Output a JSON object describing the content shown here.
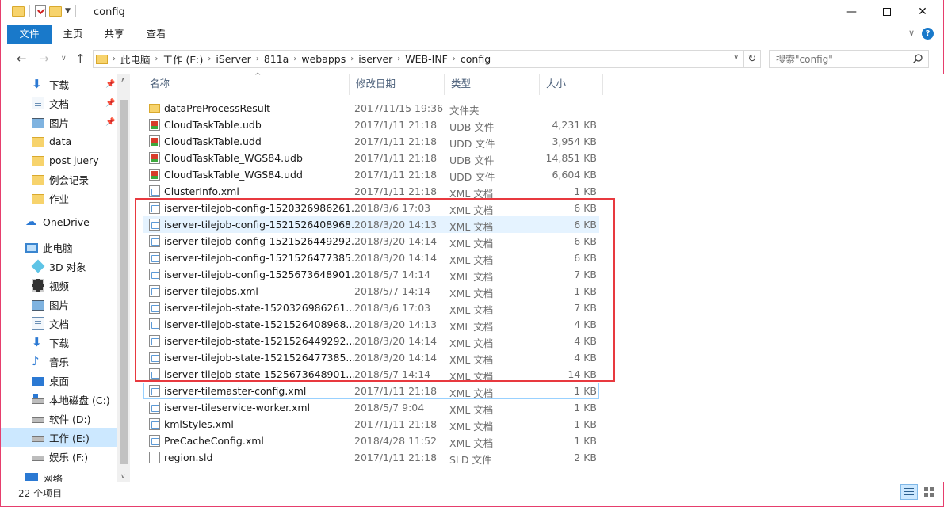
{
  "window": {
    "title": "config"
  },
  "ribbon": {
    "tabs": [
      "文件",
      "主页",
      "共享",
      "查看"
    ]
  },
  "address": {
    "crumbs": [
      "此电脑",
      "工作 (E:)",
      "iServer",
      "811a",
      "webapps",
      "iserver",
      "WEB-INF",
      "config"
    ],
    "search_placeholder": "搜索\"config\""
  },
  "nav": {
    "items": [
      {
        "label": "下载",
        "icon": "download-icon",
        "pinned": true
      },
      {
        "label": "文档",
        "icon": "document-icon",
        "pinned": true
      },
      {
        "label": "图片",
        "icon": "pictures-icon",
        "pinned": true
      },
      {
        "label": "data",
        "icon": "folder-icon",
        "pinned": false
      },
      {
        "label": "post juery",
        "icon": "folder-icon",
        "pinned": false
      },
      {
        "label": "例会记录",
        "icon": "folder-icon",
        "pinned": false
      },
      {
        "label": "作业",
        "icon": "folder-icon",
        "pinned": false
      },
      {
        "label": "OneDrive",
        "icon": "onedrive-icon",
        "pinned": false
      },
      {
        "label": "此电脑",
        "icon": "this-pc-icon",
        "pinned": false
      },
      {
        "label": "3D 对象",
        "icon": "3d-objects-icon",
        "pinned": false
      },
      {
        "label": "视频",
        "icon": "video-icon",
        "pinned": false
      },
      {
        "label": "图片",
        "icon": "pictures-icon",
        "pinned": false
      },
      {
        "label": "文档",
        "icon": "document-icon",
        "pinned": false
      },
      {
        "label": "下载",
        "icon": "download-icon",
        "pinned": false
      },
      {
        "label": "音乐",
        "icon": "music-icon",
        "pinned": false
      },
      {
        "label": "桌面",
        "icon": "desktop-icon",
        "pinned": false
      },
      {
        "label": "本地磁盘 (C:)",
        "icon": "system-drive-icon",
        "pinned": false
      },
      {
        "label": "软件 (D:)",
        "icon": "drive-icon",
        "pinned": false
      },
      {
        "label": "工作 (E:)",
        "icon": "drive-icon",
        "pinned": false,
        "selected": true
      },
      {
        "label": "娱乐 (F:)",
        "icon": "drive-icon",
        "pinned": false
      },
      {
        "label": "网络",
        "icon": "network-icon",
        "pinned": false
      }
    ]
  },
  "columns": [
    "名称",
    "修改日期",
    "类型",
    "大小"
  ],
  "files": [
    {
      "name": "dataPreProcessResult",
      "date": "2017/11/15 19:36",
      "type": "文件夹",
      "size": "",
      "icon": "folder-icon"
    },
    {
      "name": "CloudTaskTable.udb",
      "date": "2017/1/11 21:18",
      "type": "UDB 文件",
      "size": "4,231 KB",
      "icon": "udb-file-icon"
    },
    {
      "name": "CloudTaskTable.udd",
      "date": "2017/1/11 21:18",
      "type": "UDD 文件",
      "size": "3,954 KB",
      "icon": "udb-file-icon"
    },
    {
      "name": "CloudTaskTable_WGS84.udb",
      "date": "2017/1/11 21:18",
      "type": "UDB 文件",
      "size": "14,851 KB",
      "icon": "udb-file-icon"
    },
    {
      "name": "CloudTaskTable_WGS84.udd",
      "date": "2017/1/11 21:18",
      "type": "UDD 文件",
      "size": "6,604 KB",
      "icon": "udb-file-icon"
    },
    {
      "name": "ClusterInfo.xml",
      "date": "2017/1/11 21:18",
      "type": "XML 文档",
      "size": "1 KB",
      "icon": "xml-file-icon"
    },
    {
      "name": "iserver-tilejob-config-1520326986261...",
      "date": "2018/3/6 17:03",
      "type": "XML 文档",
      "size": "6 KB",
      "icon": "xml-file-icon"
    },
    {
      "name": "iserver-tilejob-config-1521526408968...",
      "date": "2018/3/20 14:13",
      "type": "XML 文档",
      "size": "6 KB",
      "icon": "xml-file-icon",
      "hover": true
    },
    {
      "name": "iserver-tilejob-config-1521526449292...",
      "date": "2018/3/20 14:14",
      "type": "XML 文档",
      "size": "6 KB",
      "icon": "xml-file-icon"
    },
    {
      "name": "iserver-tilejob-config-1521526477385...",
      "date": "2018/3/20 14:14",
      "type": "XML 文档",
      "size": "6 KB",
      "icon": "xml-file-icon"
    },
    {
      "name": "iserver-tilejob-config-1525673648901...",
      "date": "2018/5/7 14:14",
      "type": "XML 文档",
      "size": "7 KB",
      "icon": "xml-file-icon"
    },
    {
      "name": "iserver-tilejobs.xml",
      "date": "2018/5/7 14:14",
      "type": "XML 文档",
      "size": "1 KB",
      "icon": "xml-file-icon"
    },
    {
      "name": "iserver-tilejob-state-1520326986261...",
      "date": "2018/3/6 17:03",
      "type": "XML 文档",
      "size": "7 KB",
      "icon": "xml-file-icon"
    },
    {
      "name": "iserver-tilejob-state-1521526408968...",
      "date": "2018/3/20 14:13",
      "type": "XML 文档",
      "size": "4 KB",
      "icon": "xml-file-icon"
    },
    {
      "name": "iserver-tilejob-state-1521526449292...",
      "date": "2018/3/20 14:14",
      "type": "XML 文档",
      "size": "4 KB",
      "icon": "xml-file-icon"
    },
    {
      "name": "iserver-tilejob-state-1521526477385...",
      "date": "2018/3/20 14:14",
      "type": "XML 文档",
      "size": "4 KB",
      "icon": "xml-file-icon"
    },
    {
      "name": "iserver-tilejob-state-1525673648901...",
      "date": "2018/5/7 14:14",
      "type": "XML 文档",
      "size": "14 KB",
      "icon": "xml-file-icon"
    },
    {
      "name": "iserver-tilemaster-config.xml",
      "date": "2017/1/11 21:18",
      "type": "XML 文档",
      "size": "1 KB",
      "icon": "xml-file-icon",
      "focus": true
    },
    {
      "name": "iserver-tileservice-worker.xml",
      "date": "2018/5/7 9:04",
      "type": "XML 文档",
      "size": "1 KB",
      "icon": "xml-file-icon"
    },
    {
      "name": "kmlStyles.xml",
      "date": "2017/1/11 21:18",
      "type": "XML 文档",
      "size": "1 KB",
      "icon": "xml-file-icon"
    },
    {
      "name": "PreCacheConfig.xml",
      "date": "2018/4/28 11:52",
      "type": "XML 文档",
      "size": "1 KB",
      "icon": "xml-file-icon"
    },
    {
      "name": "region.sld",
      "date": "2017/1/11 21:18",
      "type": "SLD 文件",
      "size": "2 KB",
      "icon": "sld-file-icon"
    }
  ],
  "status": {
    "item_count": "22 个项目"
  },
  "colors": {
    "accent": "#1979ca",
    "highlight_box": "#e8393f",
    "selection": "#cce8ff"
  }
}
